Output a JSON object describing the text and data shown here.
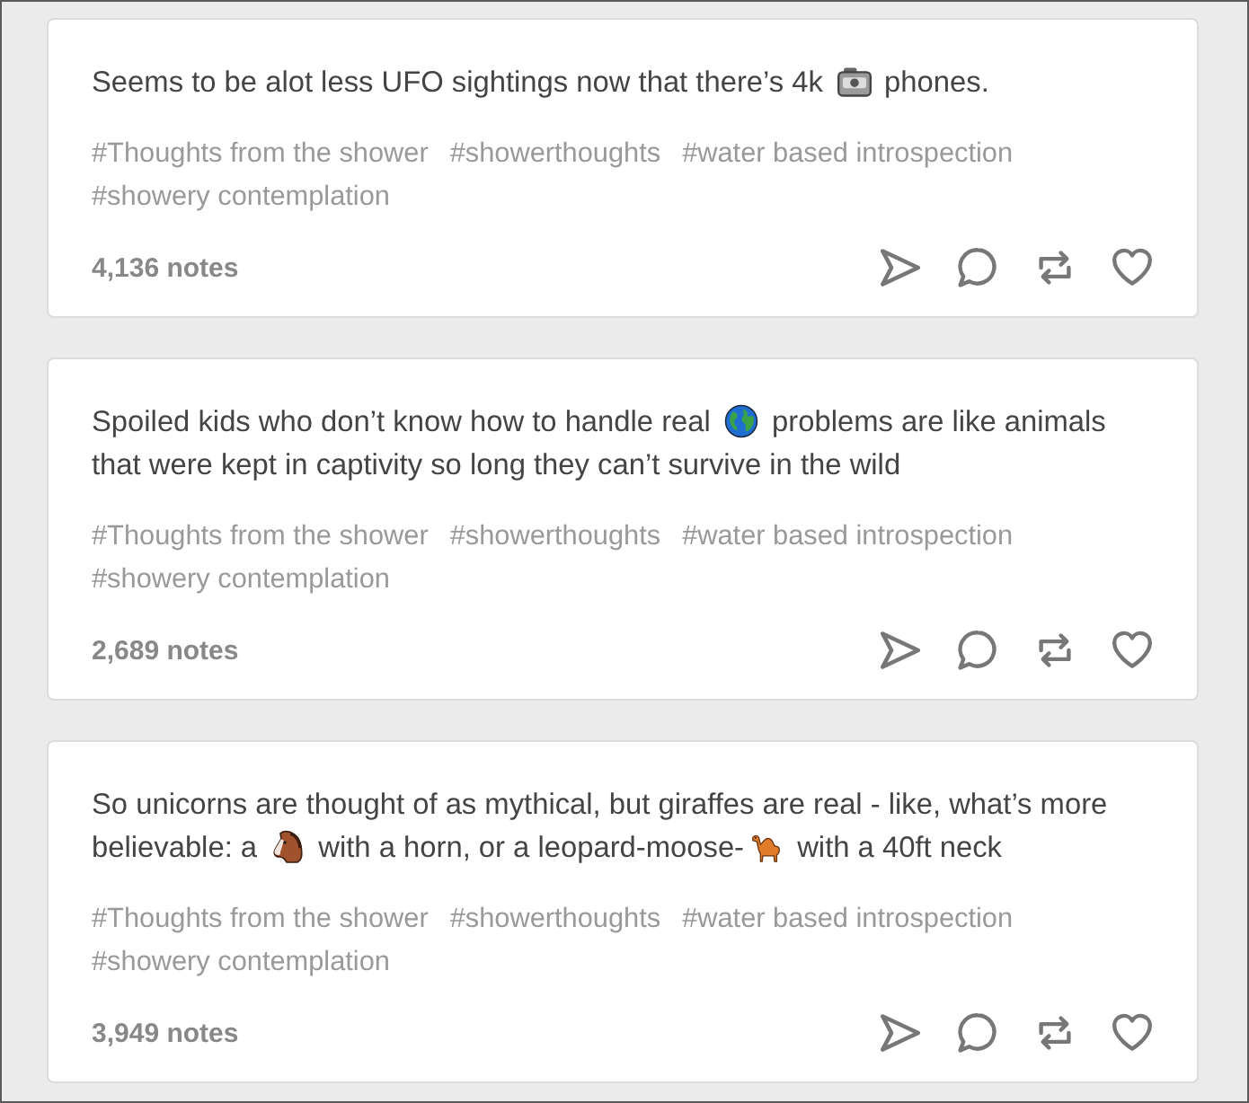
{
  "posts": [
    {
      "body": [
        {
          "kind": "text",
          "text": "Seems to be alot less UFO sightings now that there’s 4k "
        },
        {
          "kind": "camera"
        },
        {
          "kind": "text",
          "text": " phones."
        }
      ],
      "tags": [
        "#Thoughts from the shower",
        "#showerthoughts",
        "#water based introspection",
        "#showery contemplation"
      ],
      "notes": "4,136 notes"
    },
    {
      "body": [
        {
          "kind": "text",
          "text": "Spoiled kids who don’t know how to handle real "
        },
        {
          "kind": "globe"
        },
        {
          "kind": "text",
          "text": " problems are like animals that were kept in captivity so long they can’t survive in the wild"
        }
      ],
      "tags": [
        "#Thoughts from the shower",
        "#showerthoughts",
        "#water based introspection",
        "#showery contemplation"
      ],
      "notes": "2,689 notes"
    },
    {
      "body": [
        {
          "kind": "text",
          "text": "So unicorns are thought of as mythical, but giraffes are real - like, what’s more believable: a "
        },
        {
          "kind": "horse"
        },
        {
          "kind": "text",
          "text": " with a horn, or a leopard-moose-"
        },
        {
          "kind": "camel"
        },
        {
          "kind": "text",
          "text": " with a 40ft neck"
        }
      ],
      "tags": [
        "#Thoughts from the shower",
        "#showerthoughts",
        "#water based introspection",
        "#showery contemplation"
      ],
      "notes": "3,949 notes"
    }
  ]
}
